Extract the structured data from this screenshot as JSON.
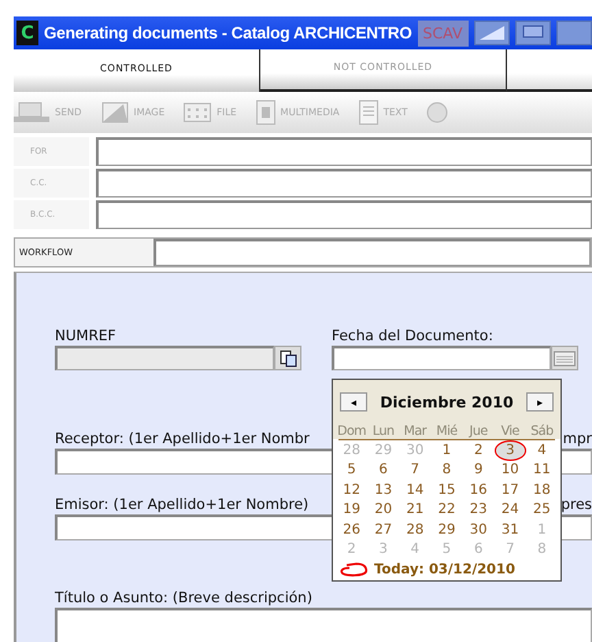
{
  "window": {
    "icon_letter": "C",
    "title": "Generating documents - Catalog ARCHICENTRO",
    "badge": "SCAV"
  },
  "tabs": [
    {
      "label": "CONTROLLED",
      "selected": true
    },
    {
      "label": "NOT CONTROLLED",
      "selected": false
    }
  ],
  "toolbar": [
    {
      "kind": "send",
      "label": "SEND",
      "disabled": true
    },
    {
      "kind": "image",
      "label": "IMAGE",
      "disabled": true
    },
    {
      "kind": "file",
      "label": "FILE",
      "disabled": true
    },
    {
      "kind": "multimedia",
      "label": "MULTIMEDIA",
      "disabled": true
    },
    {
      "kind": "text",
      "label": "TEXT",
      "disabled": true
    },
    {
      "kind": "globe",
      "disabled": true
    }
  ],
  "recipients": [
    {
      "label": "FOR"
    },
    {
      "label": "C.C."
    },
    {
      "label": "B.C.C."
    }
  ],
  "workflow": {
    "label": "WORKFLOW"
  },
  "form": {
    "numref": {
      "label": "NUMREF"
    },
    "fecha": {
      "label": "Fecha del Documento:"
    },
    "receptor": {
      "label": "Receptor: (1er Apellido+1er Nombr",
      "tail": "mpr"
    },
    "emisor": {
      "label": "Emisor: (1er Apellido+1er Nombre)",
      "tail": "pres"
    },
    "titulo": {
      "label": "Título o Asunto: (Breve descripción)"
    }
  },
  "calendar": {
    "prev": "◂",
    "next": "▸",
    "month": "Diciembre 2010",
    "weekdays": [
      "Dom",
      "Lun",
      "Mar",
      "Mié",
      "Jue",
      "Vie",
      "Sáb"
    ],
    "weeks": [
      [
        {
          "day": "28",
          "kind": "other",
          "selected": false
        },
        {
          "day": "29",
          "kind": "other",
          "selected": false
        },
        {
          "day": "30",
          "kind": "other",
          "selected": false
        },
        {
          "day": "1",
          "kind": "current",
          "selected": false
        },
        {
          "day": "2",
          "kind": "current",
          "selected": false
        },
        {
          "day": "3",
          "kind": "current",
          "selected": true
        },
        {
          "day": "4",
          "kind": "current",
          "selected": false
        }
      ],
      [
        {
          "day": "5",
          "kind": "current",
          "selected": false
        },
        {
          "day": "6",
          "kind": "current",
          "selected": false
        },
        {
          "day": "7",
          "kind": "current",
          "selected": false
        },
        {
          "day": "8",
          "kind": "current",
          "selected": false
        },
        {
          "day": "9",
          "kind": "current",
          "selected": false
        },
        {
          "day": "10",
          "kind": "current",
          "selected": false
        },
        {
          "day": "11",
          "kind": "current",
          "selected": false
        }
      ],
      [
        {
          "day": "12",
          "kind": "current",
          "selected": false
        },
        {
          "day": "13",
          "kind": "current",
          "selected": false
        },
        {
          "day": "14",
          "kind": "current",
          "selected": false
        },
        {
          "day": "15",
          "kind": "current",
          "selected": false
        },
        {
          "day": "16",
          "kind": "current",
          "selected": false
        },
        {
          "day": "17",
          "kind": "current",
          "selected": false
        },
        {
          "day": "18",
          "kind": "current",
          "selected": false
        }
      ],
      [
        {
          "day": "19",
          "kind": "current",
          "selected": false
        },
        {
          "day": "20",
          "kind": "current",
          "selected": false
        },
        {
          "day": "21",
          "kind": "current",
          "selected": false
        },
        {
          "day": "22",
          "kind": "current",
          "selected": false
        },
        {
          "day": "23",
          "kind": "current",
          "selected": false
        },
        {
          "day": "24",
          "kind": "current",
          "selected": false
        },
        {
          "day": "25",
          "kind": "current",
          "selected": false
        }
      ],
      [
        {
          "day": "26",
          "kind": "current",
          "selected": false
        },
        {
          "day": "27",
          "kind": "current",
          "selected": false
        },
        {
          "day": "28",
          "kind": "current",
          "selected": false
        },
        {
          "day": "29",
          "kind": "current",
          "selected": false
        },
        {
          "day": "30",
          "kind": "current",
          "selected": false
        },
        {
          "day": "31",
          "kind": "current",
          "selected": false
        },
        {
          "day": "1",
          "kind": "other",
          "selected": false
        }
      ],
      [
        {
          "day": "2",
          "kind": "other",
          "selected": false
        },
        {
          "day": "3",
          "kind": "other",
          "selected": false
        },
        {
          "day": "4",
          "kind": "other",
          "selected": false
        },
        {
          "day": "5",
          "kind": "other",
          "selected": false
        },
        {
          "day": "6",
          "kind": "other",
          "selected": false
        },
        {
          "day": "7",
          "kind": "other",
          "selected": false
        },
        {
          "day": "8",
          "kind": "other",
          "selected": false
        }
      ]
    ],
    "today": "Today: 03/12/2010"
  }
}
